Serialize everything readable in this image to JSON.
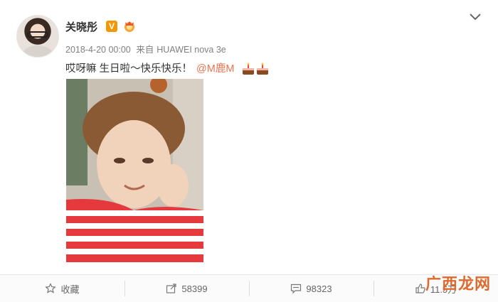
{
  "post": {
    "author": "关晓彤",
    "timestamp": "2018-4-20 00:00",
    "source_prefix": "来自",
    "source": "HUAWEI nova 3e",
    "text": "哎呀嘛 生日啦～快乐快乐！",
    "mention": "@M鹿M"
  },
  "actions": {
    "favorite": "收藏",
    "repost_count": "58399",
    "comment_count": "98323",
    "like_count": "11.5万"
  },
  "icons": {
    "verified": "verified-v-badge-icon",
    "medal": "fan-medal-icon",
    "more": "chevron-down-icon",
    "cake": "birthday-cake-icon",
    "star": "star-icon",
    "share": "share-icon",
    "comment": "comment-icon",
    "like": "thumbs-up-icon"
  },
  "colors": {
    "accent": "#eb7350",
    "verified": "#f39800",
    "meta": "#808080"
  },
  "watermark": "广西龙网"
}
